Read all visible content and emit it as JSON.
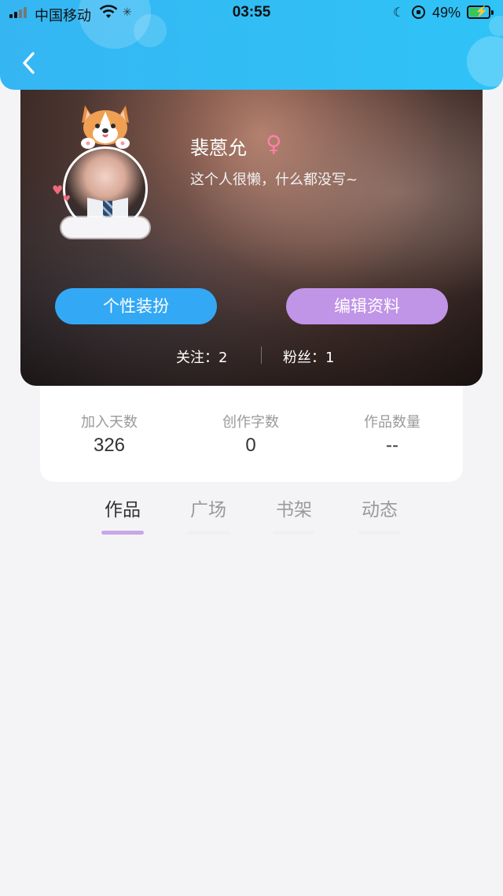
{
  "status_bar": {
    "carrier": "中国移动",
    "time": "03:55",
    "battery_percent": "49%",
    "battery_level": 0.49,
    "icons": [
      "signal-icon",
      "wifi-icon",
      "loading-icon",
      "moon-icon",
      "rotation-lock-icon",
      "battery-charging-icon"
    ]
  },
  "header": {
    "back_icon": "chevron-left-icon",
    "color": "#35b6f3"
  },
  "profile": {
    "name": "裴蒽允",
    "gender_symbol": "♀",
    "signature": "这个人很懒，什么都没写~",
    "buttons": {
      "dress_up": "个性装扮",
      "edit_profile": "编辑资料"
    },
    "follow_text": "关注：2",
    "fans_text": "粉丝：1",
    "colors": {
      "dress_up": "#33a8f5",
      "edit_profile": "#c094e6",
      "gender": "#ff7fa8"
    }
  },
  "stats": [
    {
      "label": "加入天数",
      "value": "326"
    },
    {
      "label": "创作字数",
      "value": "0"
    },
    {
      "label": "作品数量",
      "value": "--"
    }
  ],
  "tabs": [
    {
      "label": "作品",
      "active": true
    },
    {
      "label": "广场",
      "active": false
    },
    {
      "label": "书架",
      "active": false
    },
    {
      "label": "动态",
      "active": false
    }
  ]
}
